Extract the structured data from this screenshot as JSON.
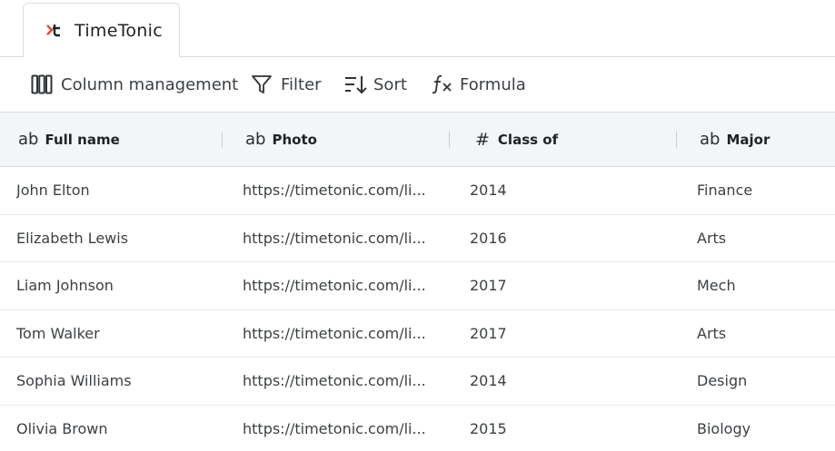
{
  "tab": {
    "title": "TimeTonic",
    "logo_color": "#e8462e"
  },
  "toolbar": {
    "column_management": "Column management",
    "filter": "Filter",
    "sort": "Sort",
    "formula": "Formula"
  },
  "columns": [
    {
      "type_icon": "ab",
      "label": "Full name"
    },
    {
      "type_icon": "ab",
      "label": "Photo"
    },
    {
      "type_icon": "#",
      "label": "Class of"
    },
    {
      "type_icon": "ab",
      "label": "Major"
    }
  ],
  "rows": [
    [
      "John Elton",
      "https://timetonic.com/li...",
      "2014",
      "Finance"
    ],
    [
      "Elizabeth Lewis",
      "https://timetonic.com/li...",
      "2016",
      "Arts"
    ],
    [
      "Liam Johnson",
      "https://timetonic.com/li...",
      "2017",
      "Mech"
    ],
    [
      "Tom Walker",
      "https://timetonic.com/li...",
      "2017",
      "Arts"
    ],
    [
      "Sophia Williams",
      "https://timetonic.com/li...",
      "2014",
      "Design"
    ],
    [
      "Olivia Brown",
      "https://timetonic.com/li...",
      "2015",
      "Biology"
    ]
  ]
}
